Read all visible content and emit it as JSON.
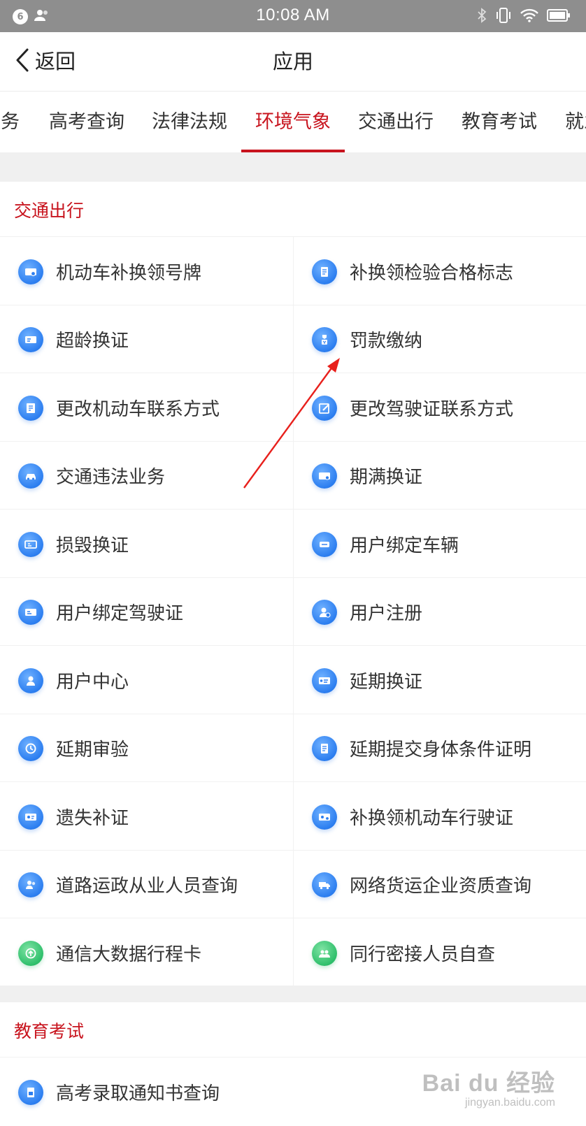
{
  "status_bar": {
    "notification_count": "6",
    "time": "10:08 AM"
  },
  "header": {
    "back_label": "返回",
    "title": "应用"
  },
  "tabs": [
    {
      "label": "服务",
      "active": false
    },
    {
      "label": "高考查询",
      "active": false
    },
    {
      "label": "法律法规",
      "active": false
    },
    {
      "label": "环境气象",
      "active": true
    },
    {
      "label": "交通出行",
      "active": false
    },
    {
      "label": "教育考试",
      "active": false
    },
    {
      "label": "就业",
      "active": false
    }
  ],
  "sections": [
    {
      "title": "交通出行",
      "items": [
        {
          "label": "机动车补换领号牌",
          "icon": "license-plate-icon"
        },
        {
          "label": "补换领检验合格标志",
          "icon": "inspection-sticker-icon"
        },
        {
          "label": "超龄换证",
          "icon": "id-card-icon"
        },
        {
          "label": "罚款缴纳",
          "icon": "fine-payment-icon"
        },
        {
          "label": "更改机动车联系方式",
          "icon": "edit-document-icon"
        },
        {
          "label": "更改驾驶证联系方式",
          "icon": "edit-icon"
        },
        {
          "label": "交通违法业务",
          "icon": "car-icon"
        },
        {
          "label": "期满换证",
          "icon": "id-card-icon"
        },
        {
          "label": "损毁换证",
          "icon": "damaged-card-icon"
        },
        {
          "label": "用户绑定车辆",
          "icon": "car-bind-icon"
        },
        {
          "label": "用户绑定驾驶证",
          "icon": "license-bind-icon"
        },
        {
          "label": "用户注册",
          "icon": "user-add-icon"
        },
        {
          "label": "用户中心",
          "icon": "user-icon"
        },
        {
          "label": "延期换证",
          "icon": "id-card-icon"
        },
        {
          "label": "延期审验",
          "icon": "clock-icon"
        },
        {
          "label": "延期提交身体条件证明",
          "icon": "document-icon"
        },
        {
          "label": "遗失补证",
          "icon": "id-card-icon"
        },
        {
          "label": "补换领机动车行驶证",
          "icon": "id-card-icon"
        },
        {
          "label": "道路运政从业人员查询",
          "icon": "people-icon"
        },
        {
          "label": "网络货运企业资质查询",
          "icon": "truck-icon"
        },
        {
          "label": "通信大数据行程卡",
          "icon": "arrow-up-icon",
          "color": "green"
        },
        {
          "label": "同行密接人员自查",
          "icon": "group-icon",
          "color": "green"
        }
      ]
    },
    {
      "title": "教育考试",
      "items": [
        {
          "label": "高考录取通知书查询",
          "icon": "notice-icon"
        }
      ]
    }
  ],
  "watermark": {
    "main": "Bai du 经验",
    "sub": "jingyan.baidu.com"
  },
  "colors": {
    "accent": "#c8141e",
    "icon_blue": "#2c7ef0",
    "icon_green": "#2fbf6b",
    "arrow": "#e8201c"
  }
}
